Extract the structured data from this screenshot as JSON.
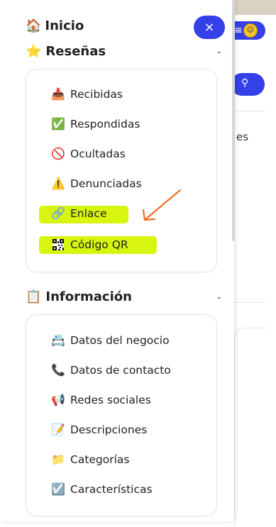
{
  "header": {
    "home_label": "Inicio",
    "close_icon": "×"
  },
  "sections": [
    {
      "title": "Reseñas",
      "collapse_symbol": "-",
      "items": [
        {
          "label": "Recibidas",
          "icon": "inbox-icon"
        },
        {
          "label": "Respondidas",
          "icon": "check-box-icon"
        },
        {
          "label": "Ocultadas",
          "icon": "prohibited-icon"
        },
        {
          "label": "Denunciadas",
          "icon": "warning-icon"
        },
        {
          "label": "Enlace",
          "icon": "link-icon",
          "highlighted": true
        },
        {
          "label": "Código QR",
          "icon": "qr-code-icon",
          "highlighted": true
        }
      ]
    },
    {
      "title": "Información",
      "collapse_symbol": "-",
      "items": [
        {
          "label": "Datos del negocio",
          "icon": "card-icon"
        },
        {
          "label": "Datos de contacto",
          "icon": "phone-icon"
        },
        {
          "label": "Redes sociales",
          "icon": "megaphone-icon"
        },
        {
          "label": "Descripciones",
          "icon": "memo-icon"
        },
        {
          "label": "Categorías",
          "icon": "folder-icon"
        },
        {
          "label": "Características",
          "icon": "check-box-icon"
        }
      ]
    }
  ],
  "background": {
    "partial_text": "es"
  },
  "colors": {
    "accent": "#3440e8",
    "highlight": "#d7f50f",
    "arrow": "#f07020"
  }
}
